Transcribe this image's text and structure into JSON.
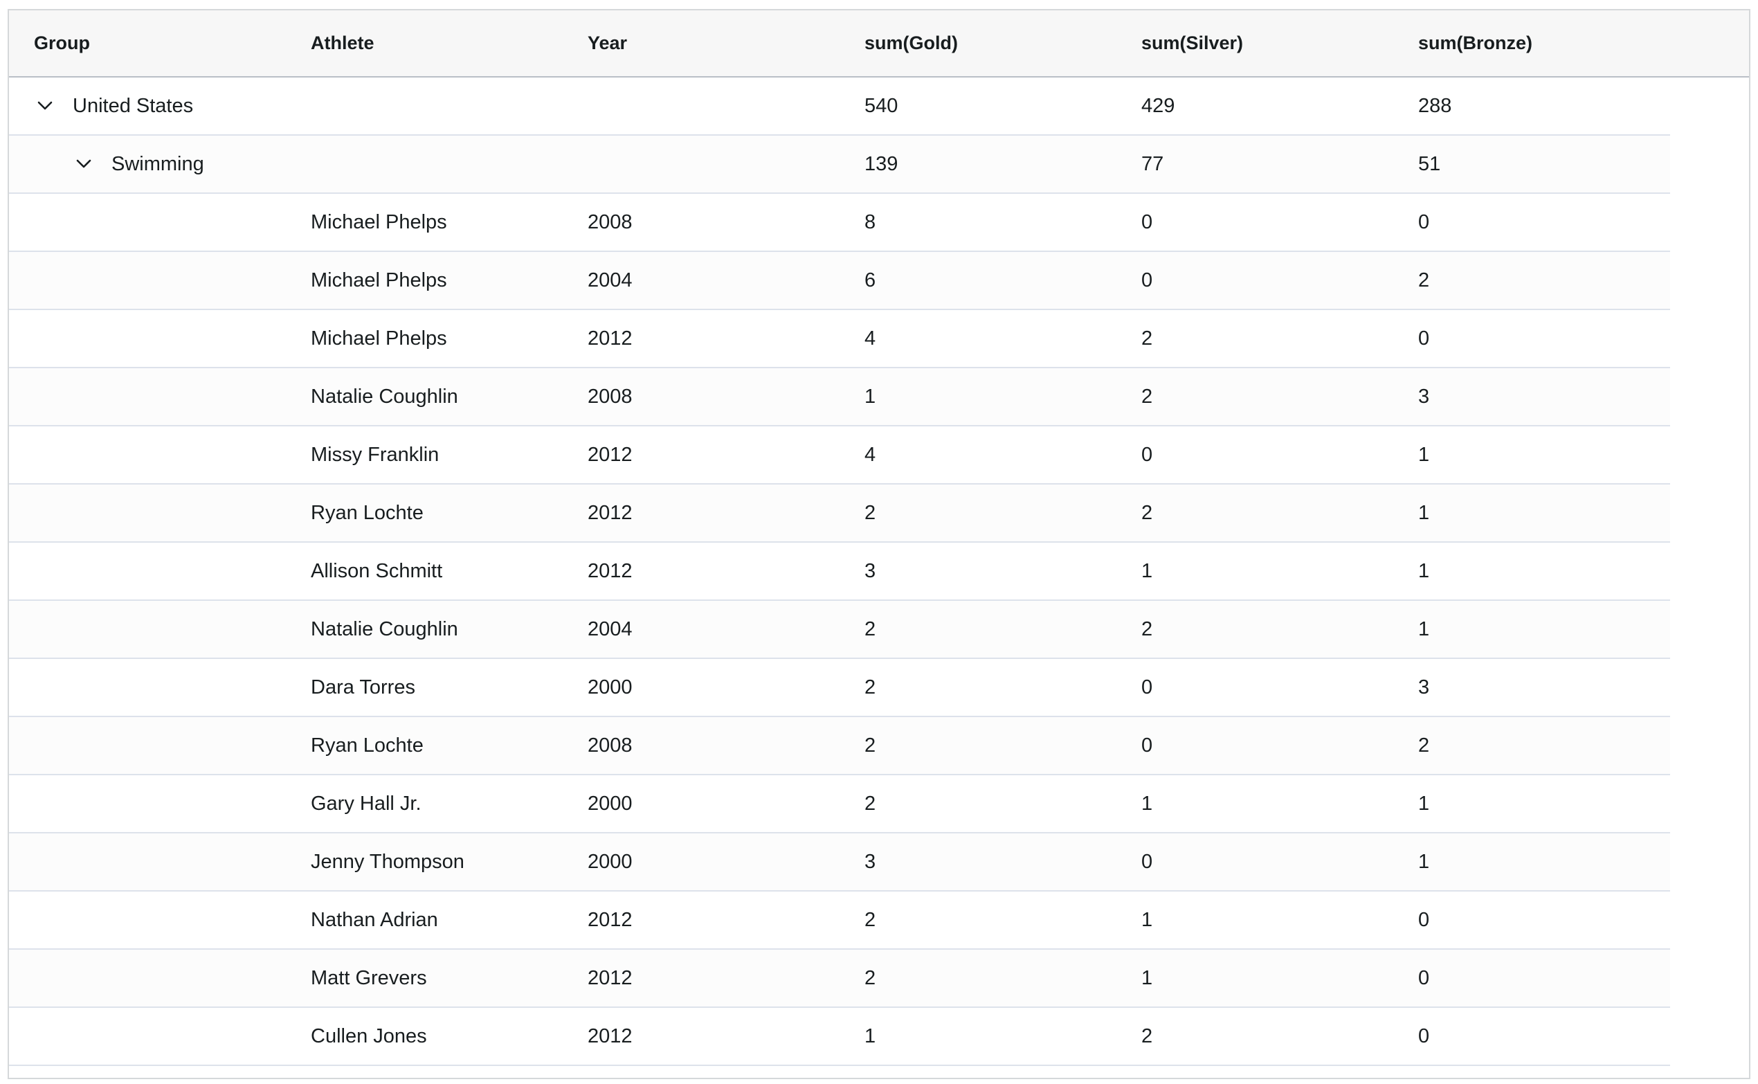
{
  "columns": {
    "group": "Group",
    "athlete": "Athlete",
    "year": "Year",
    "gold": "sum(Gold)",
    "silver": "sum(Silver)",
    "bronze": "sum(Bronze)"
  },
  "country_group": {
    "name": "United States",
    "gold": "540",
    "silver": "429",
    "bronze": "288",
    "expanded": true
  },
  "sport_group": {
    "name": "Swimming",
    "gold": "139",
    "silver": "77",
    "bronze": "51",
    "expanded": true
  },
  "rows": [
    {
      "athlete": "Michael Phelps",
      "year": "2008",
      "gold": "8",
      "silver": "0",
      "bronze": "0"
    },
    {
      "athlete": "Michael Phelps",
      "year": "2004",
      "gold": "6",
      "silver": "0",
      "bronze": "2"
    },
    {
      "athlete": "Michael Phelps",
      "year": "2012",
      "gold": "4",
      "silver": "2",
      "bronze": "0"
    },
    {
      "athlete": "Natalie Coughlin",
      "year": "2008",
      "gold": "1",
      "silver": "2",
      "bronze": "3"
    },
    {
      "athlete": "Missy Franklin",
      "year": "2012",
      "gold": "4",
      "silver": "0",
      "bronze": "1"
    },
    {
      "athlete": "Ryan Lochte",
      "year": "2012",
      "gold": "2",
      "silver": "2",
      "bronze": "1"
    },
    {
      "athlete": "Allison Schmitt",
      "year": "2012",
      "gold": "3",
      "silver": "1",
      "bronze": "1"
    },
    {
      "athlete": "Natalie Coughlin",
      "year": "2004",
      "gold": "2",
      "silver": "2",
      "bronze": "1"
    },
    {
      "athlete": "Dara Torres",
      "year": "2000",
      "gold": "2",
      "silver": "0",
      "bronze": "3"
    },
    {
      "athlete": "Ryan Lochte",
      "year": "2008",
      "gold": "2",
      "silver": "0",
      "bronze": "2"
    },
    {
      "athlete": "Gary Hall Jr.",
      "year": "2000",
      "gold": "2",
      "silver": "1",
      "bronze": "1"
    },
    {
      "athlete": "Jenny Thompson",
      "year": "2000",
      "gold": "3",
      "silver": "0",
      "bronze": "1"
    },
    {
      "athlete": "Nathan Adrian",
      "year": "2012",
      "gold": "2",
      "silver": "1",
      "bronze": "0"
    },
    {
      "athlete": "Matt Grevers",
      "year": "2012",
      "gold": "2",
      "silver": "1",
      "bronze": "0"
    },
    {
      "athlete": "Cullen Jones",
      "year": "2012",
      "gold": "1",
      "silver": "2",
      "bronze": "0"
    }
  ]
}
